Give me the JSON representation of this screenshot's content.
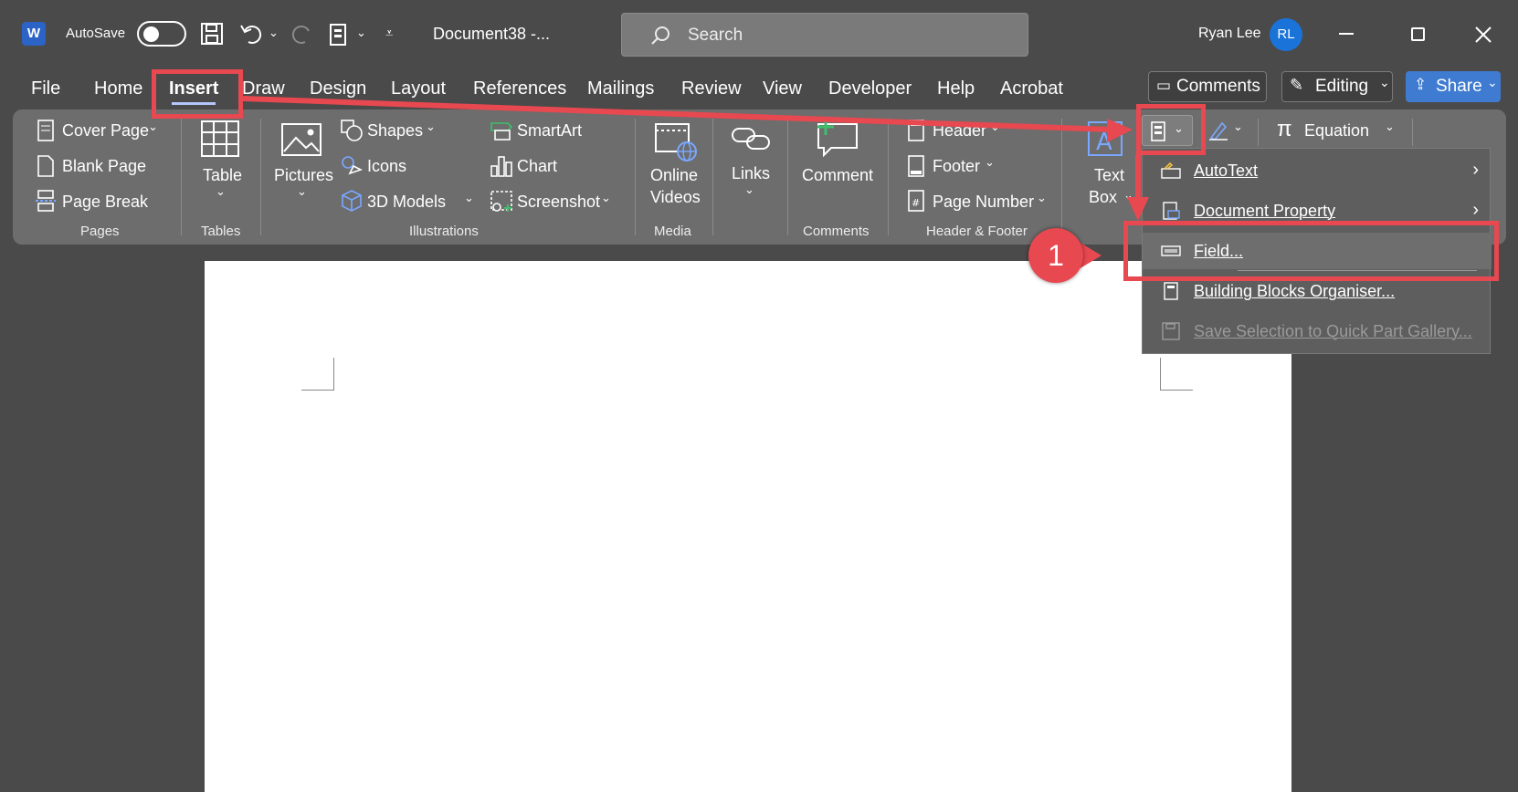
{
  "titlebar": {
    "autosave_label": "AutoSave",
    "doc_title": "Document38  -...",
    "search_placeholder": "Search",
    "user_name": "Ryan Lee",
    "user_initials": "RL"
  },
  "menu": {
    "tabs": [
      "File",
      "Home",
      "Insert",
      "Draw",
      "Design",
      "Layout",
      "References",
      "Mailings",
      "Review",
      "View",
      "Developer",
      "Help",
      "Acrobat"
    ],
    "active_tab": "Insert",
    "comments_button": "Comments",
    "editing_button": "Editing",
    "share_button": "Share"
  },
  "ribbon": {
    "pages": {
      "group": "Pages",
      "cover_page": "Cover Page",
      "blank_page": "Blank Page",
      "page_break": "Page Break"
    },
    "tables": {
      "group": "Tables",
      "table": "Table"
    },
    "illustrations": {
      "group": "Illustrations",
      "pictures": "Pictures",
      "shapes": "Shapes",
      "icons": "Icons",
      "models_3d": "3D Models",
      "smartart": "SmartArt",
      "chart": "Chart",
      "screenshot": "Screenshot"
    },
    "media": {
      "group": "Media",
      "online": "Online",
      "videos": "Videos"
    },
    "links": {
      "label": "Links"
    },
    "comments": {
      "group": "Comments",
      "comment": "Comment"
    },
    "header_footer": {
      "group": "Header & Footer",
      "header": "Header",
      "footer": "Footer",
      "page_number": "Page Number"
    },
    "text": {
      "text": "Text",
      "box": "Box"
    },
    "equation": "Equation"
  },
  "dropdown": {
    "items": [
      {
        "label": "AutoText",
        "has_submenu": true,
        "enabled": true
      },
      {
        "label": "Document Property",
        "has_submenu": true,
        "enabled": true
      },
      {
        "label": "Field...",
        "has_submenu": false,
        "enabled": true
      },
      {
        "label": "Building Blocks Organiser...",
        "has_submenu": false,
        "enabled": true
      },
      {
        "label": "Save Selection to Quick Part Gallery...",
        "has_submenu": false,
        "enabled": false
      }
    ]
  },
  "annotation": {
    "step_number": "1",
    "color": "#e84850"
  }
}
